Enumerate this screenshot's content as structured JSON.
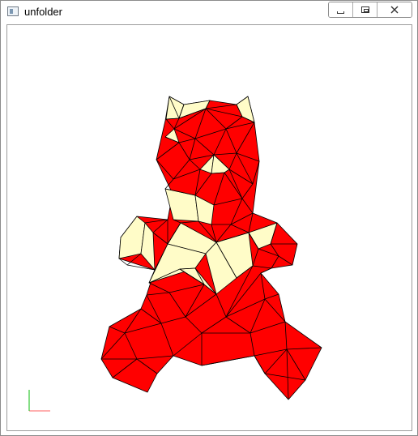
{
  "window": {
    "title": "unfolder",
    "icon": "window-app-icon"
  },
  "caption_buttons": {
    "minimize": "minimize-icon",
    "maximize": "restore-icon",
    "close": "close-icon"
  },
  "model": {
    "fill_color": "#ff0000",
    "highlight_color": "#fffcc8",
    "edge_color": "#000000"
  },
  "axes": {
    "x_color": "#ff7f7f",
    "y_color": "#32c832"
  }
}
